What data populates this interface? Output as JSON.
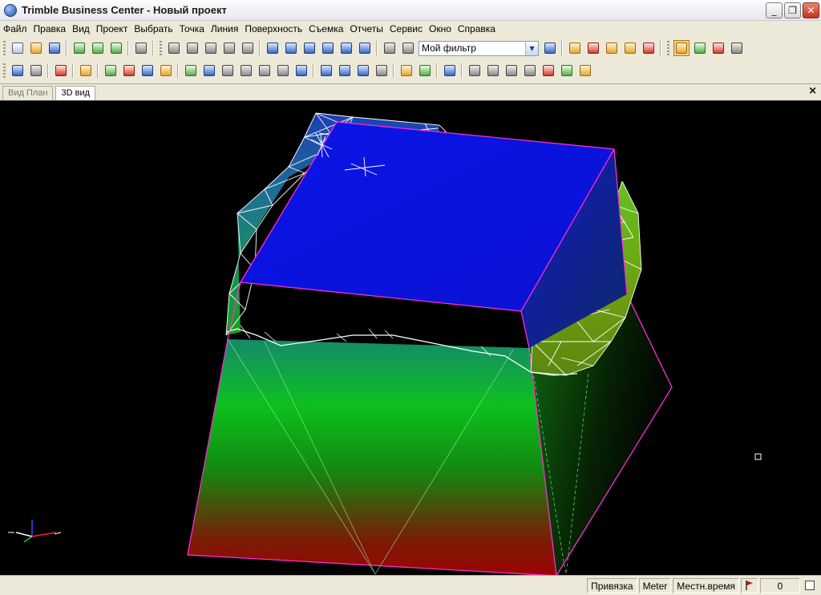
{
  "window": {
    "title": "Trimble Business Center - Новый проект",
    "minimize_glyph": "_",
    "restore_glyph": "❐",
    "close_glyph": "✕"
  },
  "menu": [
    {
      "label": "Файл"
    },
    {
      "label": "Правка"
    },
    {
      "label": "Вид"
    },
    {
      "label": "Проект"
    },
    {
      "label": "Выбрать"
    },
    {
      "label": "Точка"
    },
    {
      "label": "Линия"
    },
    {
      "label": "Поверхность"
    },
    {
      "label": "Съемка"
    },
    {
      "label": "Отчеты"
    },
    {
      "label": "Сервис"
    },
    {
      "label": "Окно"
    },
    {
      "label": "Справка"
    }
  ],
  "toolbar": {
    "filter_value": "Мой фильтр",
    "filter_arrow": "▼"
  },
  "tabs": [
    {
      "label": "Вид План",
      "active": false
    },
    {
      "label": "3D вид",
      "active": true
    }
  ],
  "tab_close": "×",
  "status": {
    "snap": "Привязка",
    "units": "Meter",
    "time": "Местн.время",
    "count": "0"
  },
  "colors": {
    "viewport_bg": "#000000",
    "top_face": "#0a14e8",
    "edge_magenta": "#ff2bd6",
    "wireframe": "#ffffff"
  }
}
